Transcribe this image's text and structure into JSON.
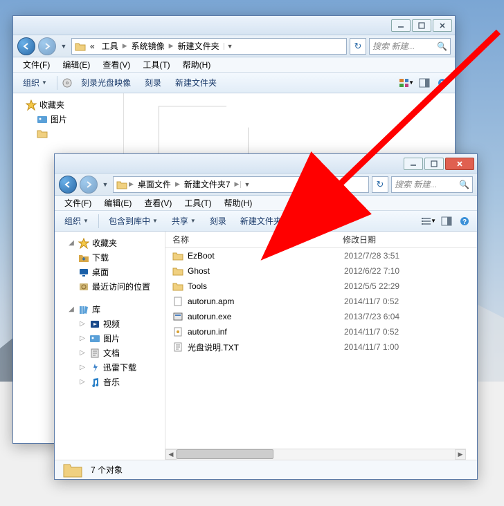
{
  "window1": {
    "titlebar": {
      "min": "—",
      "max": "▢",
      "close": "✕"
    },
    "breadcrumb": [
      "工具",
      "系统镜像",
      "新建文件夹"
    ],
    "bc_prefix": "«",
    "search_placeholder": "搜索 新建...",
    "menus": [
      "文件(F)",
      "编辑(E)",
      "查看(V)",
      "工具(T)",
      "帮助(H)"
    ],
    "toolbar": {
      "organize": "组织",
      "burn_image": "刻录光盘映像",
      "burn": "刻录",
      "new_folder": "新建文件夹"
    },
    "sidebar": {
      "favorites": "收藏夹",
      "pictures": "图片"
    }
  },
  "window2": {
    "titlebar": {
      "min": "—",
      "max": "▢",
      "close": "✕"
    },
    "breadcrumb": [
      "桌面文件",
      "新建文件夹7"
    ],
    "search_placeholder": "搜索 新建...",
    "menus": [
      "文件(F)",
      "编辑(E)",
      "查看(V)",
      "工具(T)",
      "帮助(H)"
    ],
    "toolbar": {
      "organize": "组织",
      "include_lib": "包含到库中",
      "share": "共享",
      "burn": "刻录",
      "new_folder": "新建文件夹"
    },
    "sidebar": {
      "favorites": "收藏夹",
      "downloads": "下载",
      "desktop": "桌面",
      "recent": "最近访问的位置",
      "libraries": "库",
      "videos": "视频",
      "pictures": "图片",
      "documents": "文档",
      "xunlei": "迅雷下载",
      "music": "音乐"
    },
    "columns": {
      "name": "名称",
      "modified": "修改日期"
    },
    "files": [
      {
        "icon": "folder",
        "name": "EzBoot",
        "date": "2012/7/28 3:51"
      },
      {
        "icon": "folder",
        "name": "Ghost",
        "date": "2012/6/22 7:10"
      },
      {
        "icon": "folder",
        "name": "Tools",
        "date": "2012/5/5 22:29"
      },
      {
        "icon": "file",
        "name": "autorun.apm",
        "date": "2014/11/7 0:52"
      },
      {
        "icon": "exe",
        "name": "autorun.exe",
        "date": "2013/7/23 6:04"
      },
      {
        "icon": "inf",
        "name": "autorun.inf",
        "date": "2014/11/7 0:52"
      },
      {
        "icon": "txt",
        "name": "光盘说明.TXT",
        "date": "2014/11/7 1:00"
      }
    ],
    "status": "7 个对象"
  }
}
